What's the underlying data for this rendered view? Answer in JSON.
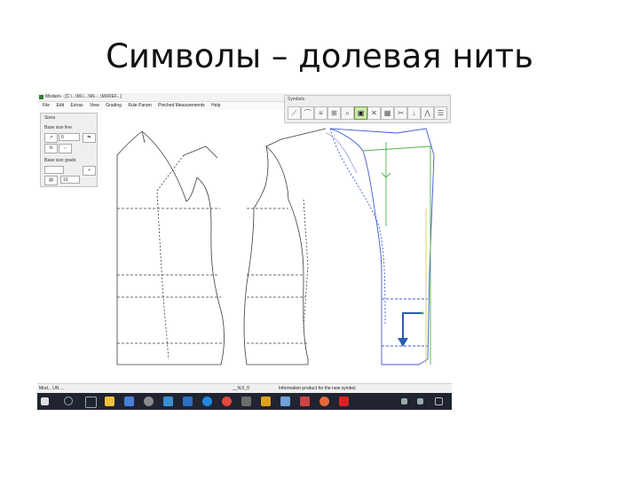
{
  "slide": {
    "title": "Символы – долевая нить"
  },
  "window": {
    "title": "Modaris - [C:\\...\\ML\\...\\ML-...\\MXREF...]",
    "menu": [
      "File",
      "Edit",
      "Extras",
      "View",
      "Grading",
      "Rule Param",
      "Pinched Measurements",
      "Help"
    ]
  },
  "toolbar_panel": {
    "caption": "Symbols",
    "tools": [
      {
        "icon": "slash-icon"
      },
      {
        "icon": "notch-icon"
      },
      {
        "icon": "seam-icon"
      },
      {
        "icon": "pattern-icon"
      },
      {
        "icon": "magnifier-icon"
      },
      {
        "icon": "grain-line-icon",
        "active": true
      },
      {
        "icon": "cross-icon"
      },
      {
        "icon": "grid-icon"
      },
      {
        "icon": "scissors-icon"
      },
      {
        "icon": "arrow-down-icon"
      },
      {
        "icon": "pleat-icon"
      },
      {
        "icon": "list-icon"
      }
    ]
  },
  "left_panel": {
    "caption": "Sizes",
    "section1": "Base size line",
    "field1": "0",
    "buttons1": [
      "↗",
      "⇆",
      "⇅",
      "⇔"
    ],
    "section2": "Base size grade",
    "field2": "10"
  },
  "status": {
    "left": "Mod... UN ...",
    "middle": "__N,0_0",
    "right": "Information product for the new symbol."
  },
  "taskbar": {
    "icons": [
      "start-icon",
      "search-icon",
      "task-view-icon",
      "explorer-icon",
      "store-icon",
      "settings-icon",
      "mail-icon",
      "photos-icon",
      "edge-icon",
      "chrome-icon",
      "app-icon",
      "tools-icon",
      "modaris-icon",
      "sketch-icon",
      "firefox-icon",
      "acrobat-icon"
    ],
    "tray": [
      "network-icon",
      "volume-icon",
      "notification-icon"
    ]
  },
  "colors": {
    "pattern_line": "#3c3c3c",
    "grainline_green": "#4caf50",
    "selected_blue": "#3d5bd6",
    "arrow_blue": "#2b5cb0",
    "taskbar": "#1f2430"
  }
}
